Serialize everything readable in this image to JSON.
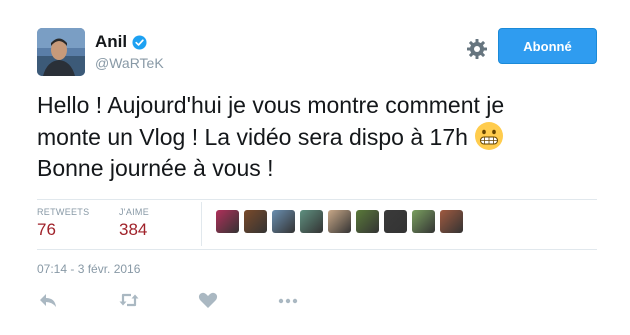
{
  "author": {
    "name": "Anil",
    "handle": "@WaRTeK"
  },
  "follow_button": {
    "label": "Abonné"
  },
  "tweet": {
    "lines": [
      "Hello ! Aujourd'hui je vous montre comment je",
      "monte un Vlog ! La vidéo sera dispo à 17h",
      "Bonne journée à vous !"
    ],
    "emoji": "grimacing-face-icon"
  },
  "stats": {
    "retweets_label": "RETWEETS",
    "retweets_value": "76",
    "likes_label": "J'AIME",
    "likes_value": "384"
  },
  "likers": [
    {
      "color": "#b0305a"
    },
    {
      "color": "#7a4a2a"
    },
    {
      "color": "#6a8fb0"
    },
    {
      "color": "#5f9080"
    },
    {
      "color": "#c8a888"
    },
    {
      "color": "#5a7a3a"
    },
    {
      "color": "#3a3a3a"
    },
    {
      "color": "#7aa060"
    },
    {
      "color": "#a05a40"
    }
  ],
  "timestamp": "07:14 - 3 févr. 2016",
  "actions": {
    "reply": "reply-icon",
    "retweet": "retweet-icon",
    "like": "heart-icon",
    "more": "more-icon"
  },
  "colors": {
    "accent": "#2f9cf0",
    "stat_value": "#a0222a",
    "muted": "#8899a6"
  }
}
